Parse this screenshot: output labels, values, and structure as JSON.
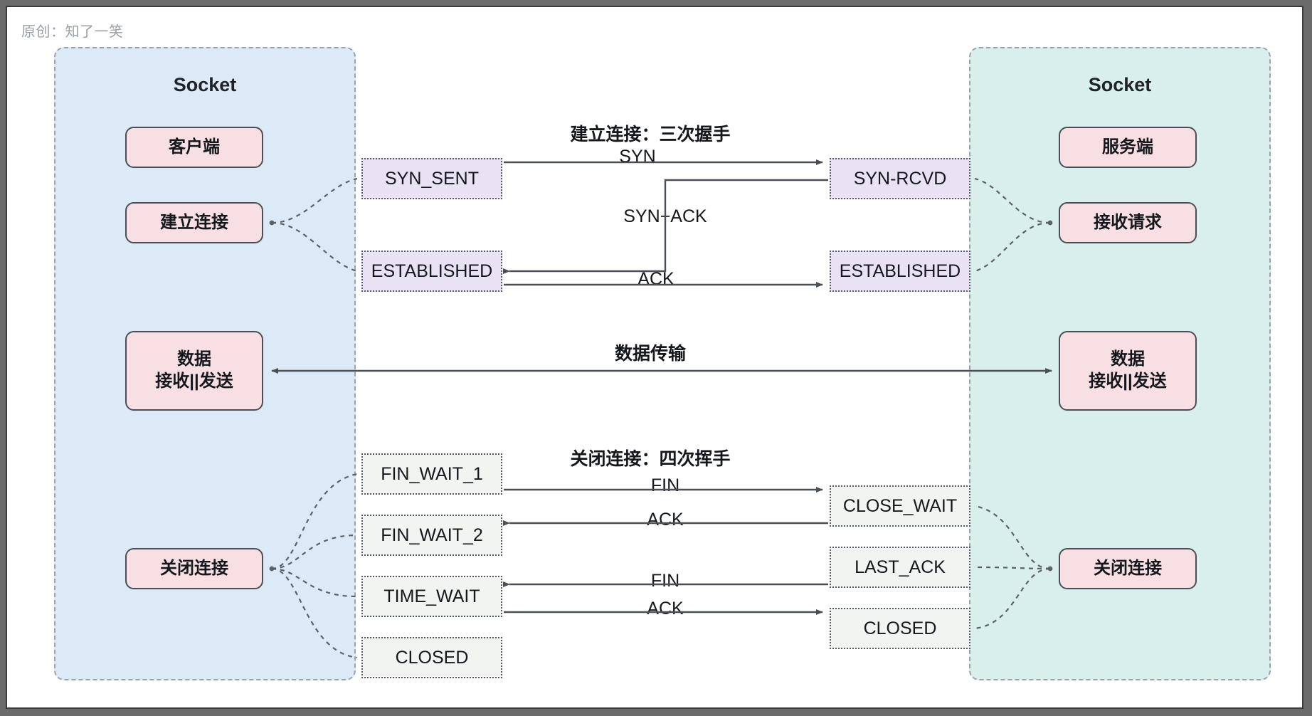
{
  "credit": "原创：知了一笑",
  "panels": {
    "client": {
      "title": "Socket",
      "roles": [
        {
          "label": "客户端"
        },
        {
          "label": "建立连接"
        },
        {
          "label": "数据\n接收||发送"
        },
        {
          "label": "关闭连接"
        }
      ]
    },
    "server": {
      "title": "Socket",
      "roles": [
        {
          "label": "服务端"
        },
        {
          "label": "接收请求"
        },
        {
          "label": "数据\n接收||发送"
        },
        {
          "label": "关闭连接"
        }
      ]
    }
  },
  "sections": {
    "handshake": "建立连接：三次握手",
    "transfer": "数据传输",
    "teardown": "关闭连接：四次挥手"
  },
  "states": {
    "client": {
      "syn_sent": "SYN_SENT",
      "established": "ESTABLISHED",
      "fin_wait_1": "FIN_WAIT_1",
      "fin_wait_2": "FIN_WAIT_2",
      "time_wait": "TIME_WAIT",
      "closed": "CLOSED"
    },
    "server": {
      "syn_rcvd": "SYN-RCVD",
      "established": "ESTABLISHED",
      "close_wait": "CLOSE_WAIT",
      "last_ack": "LAST_ACK",
      "closed": "CLOSED"
    }
  },
  "flows": {
    "syn": "SYN",
    "syn_ack": "SYN+ACK",
    "ack": "ACK",
    "fin1": "FIN",
    "ack1": "ACK",
    "fin2": "FIN",
    "ack2": "ACK"
  },
  "colors": {
    "panel_client_bg": "#dceaf7",
    "panel_server_bg": "#d9efec",
    "role_bg": "#f8dfe3",
    "state_purple_bg": "#e8e2f4",
    "state_gray_bg": "#f2f4f2",
    "stroke": "#4a4f55",
    "credit_text": "#9aa0a6"
  }
}
